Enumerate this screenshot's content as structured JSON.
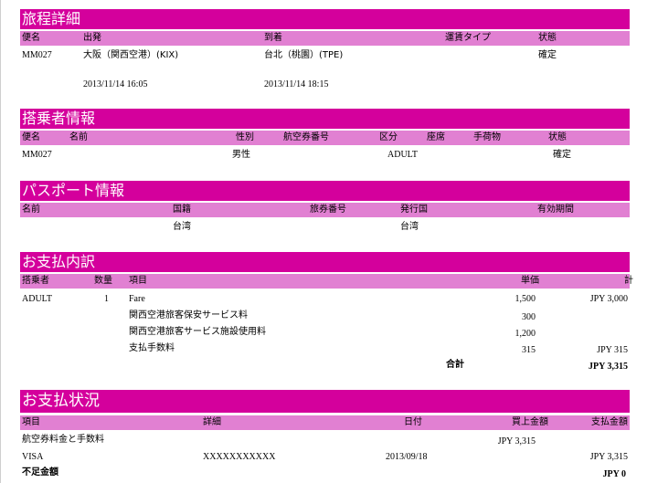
{
  "itinerary": {
    "title": "旅程詳細",
    "headers": {
      "flight": "便名",
      "departure": "出発",
      "arrival": "到着",
      "fare_type": "運賃タイプ",
      "status": "状態"
    },
    "flight": "MM027",
    "departure_place": "大阪（関西空港）(KIX)",
    "arrival_place": "台北（桃園）(TPE)",
    "status": "確定",
    "departure_time": "2013/11/14  16:05",
    "arrival_time": "2013/11/14 18:15"
  },
  "passenger": {
    "title": "搭乗者情報",
    "headers": {
      "flight": "便名",
      "name": "名前",
      "gender": "性別",
      "ticket": "航空券番号",
      "category": "区分",
      "seat": "座席",
      "baggage": "手荷物",
      "status": "状態"
    },
    "flight": "MM027",
    "gender": "男性",
    "category": "ADULT",
    "status": "確定"
  },
  "passport": {
    "title": "パスポート情報",
    "headers": {
      "name": "名前",
      "nationality": "国籍",
      "passport_no": "旅券番号",
      "issuer": "発行国",
      "expiry": "有効期間"
    },
    "nationality": "台湾",
    "issuer": "台湾"
  },
  "payment_breakdown": {
    "title": "お支払内訳",
    "headers": {
      "passenger": "搭乗者",
      "quantity": "数量",
      "item": "項目",
      "unit_price": "単価",
      "amount": "計"
    },
    "passenger": "ADULT",
    "quantity": "1",
    "rows": [
      {
        "item": "Fare",
        "unit": "1,500",
        "total": "JPY 3,000"
      },
      {
        "item": "関西空港旅客保安サービス料",
        "unit": "300",
        "total": ""
      },
      {
        "item": "関西空港旅客サービス施設使用料",
        "unit": "1,200",
        "total": ""
      },
      {
        "item": "支払手数料",
        "unit": "315",
        "total": "JPY 315"
      }
    ],
    "total_label": "合計",
    "total_value": "JPY 3,315"
  },
  "payment_status": {
    "title": "お支払状況",
    "headers": {
      "item": "項目",
      "detail": "詳細",
      "date": "日付",
      "sale_amount": "買上金額",
      "paid_amount": "支払金額"
    },
    "fee_label": "航空券料金と手数料",
    "fee_amount": "JPY  3,315",
    "method": "VISA",
    "card": "XXXXXXXXXXX",
    "date": "2013/09/18",
    "paid": "JPY 3,315",
    "shortfall_label": "不足金額",
    "shortfall_value": "JPY 0"
  }
}
